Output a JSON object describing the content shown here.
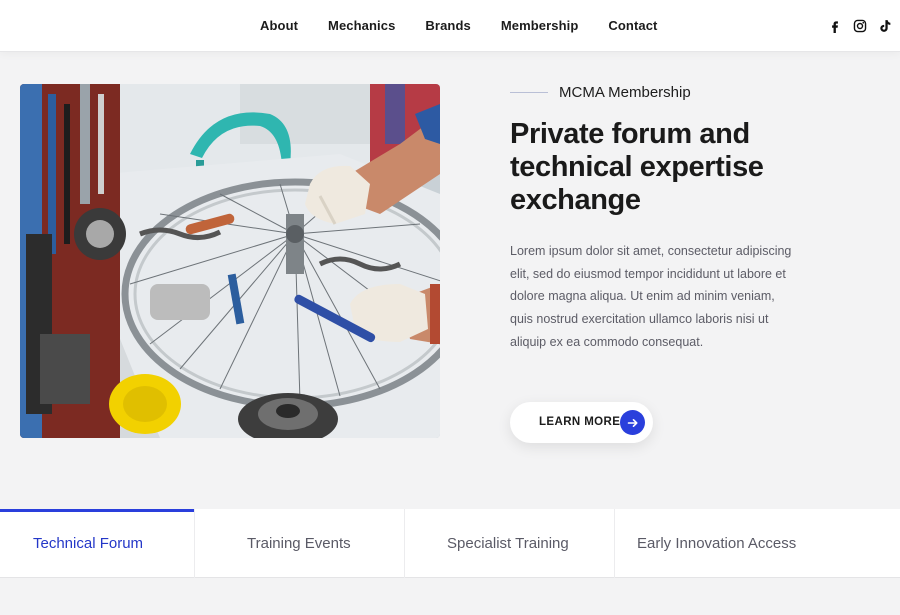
{
  "nav": {
    "items": [
      {
        "label": "About"
      },
      {
        "label": "Mechanics"
      },
      {
        "label": "Brands"
      },
      {
        "label": "Membership"
      },
      {
        "label": "Contact"
      }
    ],
    "socials": [
      {
        "icon": "facebook-icon"
      },
      {
        "icon": "instagram-icon"
      },
      {
        "icon": "tiktok-icon"
      }
    ]
  },
  "hero": {
    "eyebrow": "MCMA Membership",
    "title": "Private forum and technical expertise exchange",
    "body": "Lorem ipsum dolor sit amet, consectetur adipiscing elit, sed do eiusmod tempor incididunt ut labore et dolore magna aliqua. Ut enim ad minim veniam, quis nostrud exercitation ullamco laboris nisi ut aliquip ex ea commodo consequat.",
    "cta_label": "LEARN MORE",
    "cta_icon": "arrow-right-icon",
    "image_icon": "bicycle-mechanic-photo"
  },
  "tabs": [
    {
      "label": "Technical Forum",
      "active": true
    },
    {
      "label": "Training Events",
      "active": false
    },
    {
      "label": "Specialist Training",
      "active": false
    },
    {
      "label": "Early Innovation Access",
      "active": false
    }
  ],
  "colors": {
    "accent": "#2a3fdc",
    "active_tab_text": "#2437c8",
    "page_bg": "#f3f3f4"
  }
}
